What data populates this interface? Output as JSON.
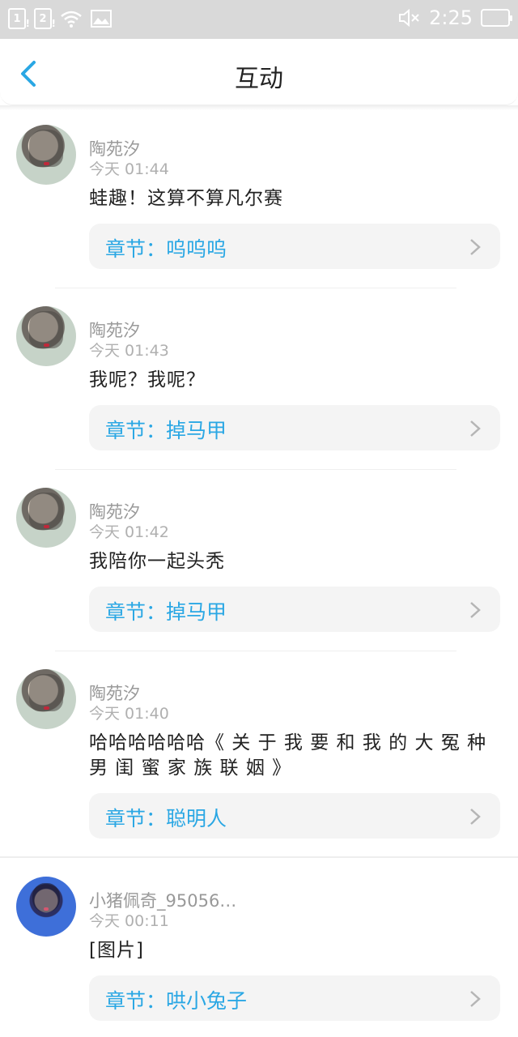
{
  "statusbar": {
    "sim1": "1",
    "sim2": "2",
    "mute_icon": "speaker-mute-icon",
    "time": "2:25"
  },
  "header": {
    "title": "互动",
    "back_icon": "chevron-left-icon"
  },
  "items": [
    {
      "name": "陶苑汐",
      "time": "今天 01:44",
      "text": "蛙趣！这算不算凡尔赛",
      "chapter": "章节：呜呜呜"
    },
    {
      "name": "陶苑汐",
      "time": "今天 01:43",
      "text": "我呢？我呢？",
      "chapter": "章节：掉马甲"
    },
    {
      "name": "陶苑汐",
      "time": "今天 01:42",
      "text": "我陪你一起头秃",
      "chapter": "章节：掉马甲"
    },
    {
      "name": "陶苑汐",
      "time": "今天 01:40",
      "text": "哈哈哈哈哈哈《 关 于 我 要 和 我 的 大 冤 种 男 闺 蜜 家 族 联 姻 》",
      "chapter": "章节：聪明人"
    },
    {
      "name": "小猪佩奇_95056…",
      "time": "今天 00:11",
      "text": "[图片]",
      "chapter": "章节：哄小兔子"
    }
  ],
  "colors": {
    "accent": "#2aa7e4",
    "statusbar": "#d9d9d9"
  }
}
